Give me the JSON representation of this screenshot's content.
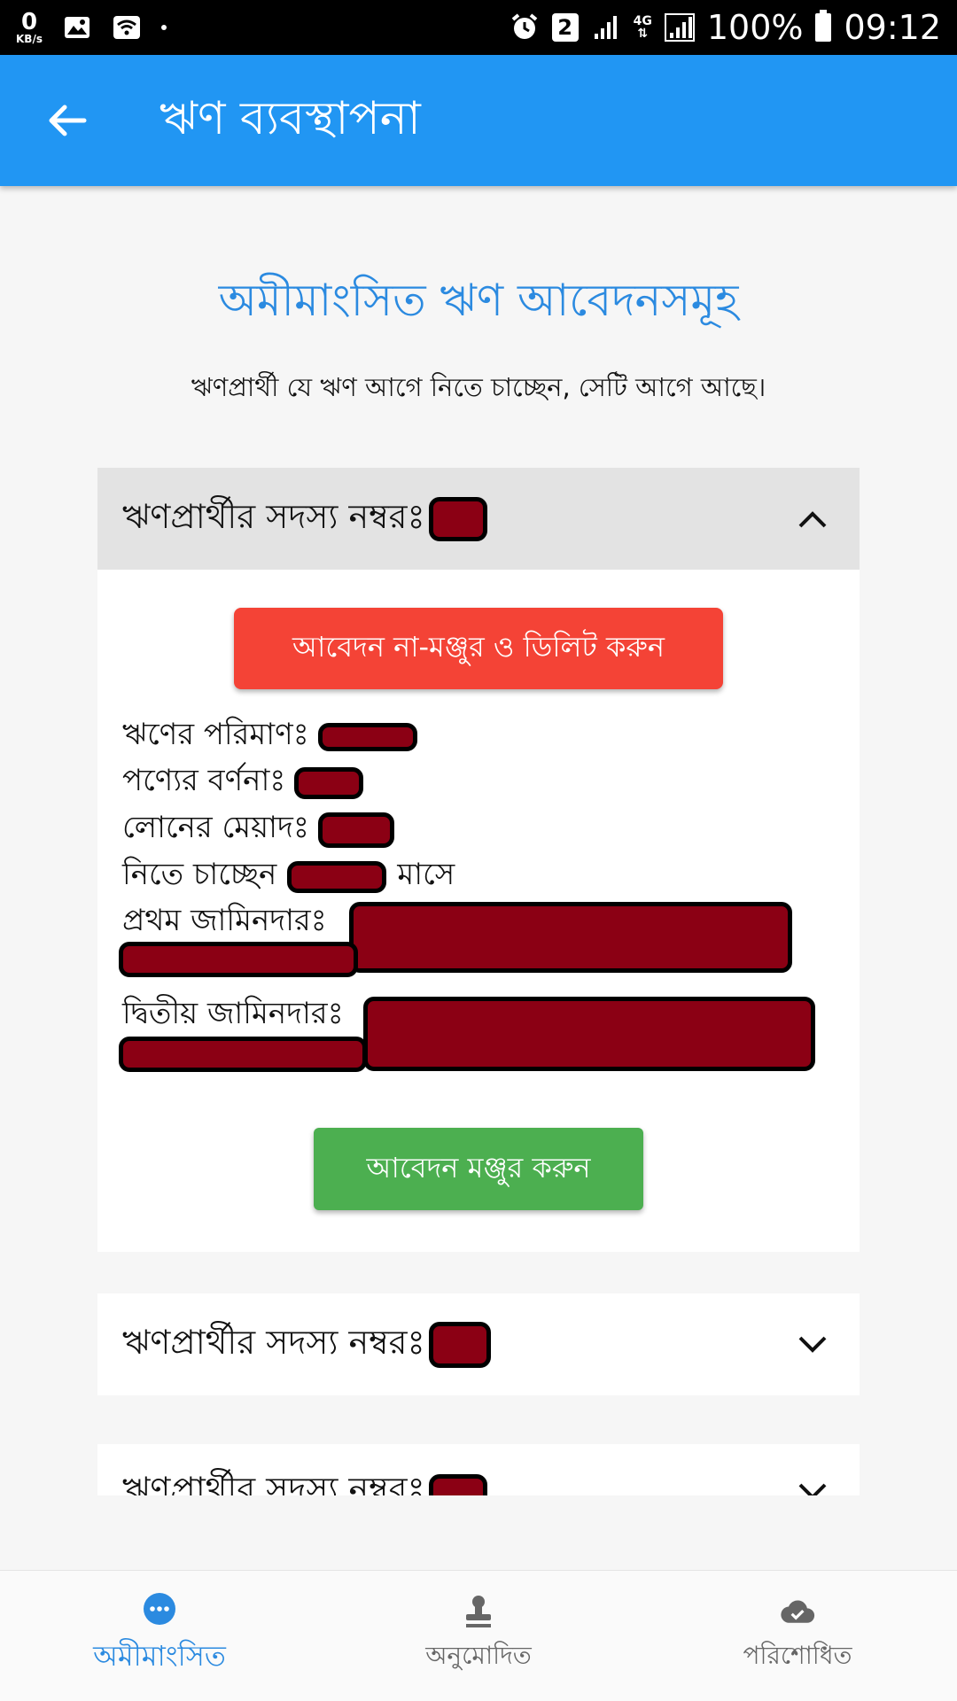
{
  "status_bar": {
    "speed_value": "0",
    "speed_unit": "KB/s",
    "sim_slot": "2",
    "network": "4G",
    "battery": "100%",
    "time": "09:12"
  },
  "app_bar": {
    "title": "ঋণ ব্যবস্থাপনা"
  },
  "page": {
    "title": "অমীমাংসিত ঋণ আবেদনসমূহ",
    "subtitle": "ঋণপ্রার্থী যে ঋণ আগে নিতে চাচ্ছেন, সেটি আগে আছে।"
  },
  "cards": [
    {
      "label": "ঋণপ্রার্থীর সদস্য নম্বরঃ",
      "expanded": true,
      "reject_button": "আবেদন না-মঞ্জুর ও ডিলিট করুন",
      "details": {
        "amount_label": "ঋণের পরিমাণঃ",
        "product_label": "পণ্যের বর্ণনাঃ",
        "duration_label": "লোনের মেয়াদঃ",
        "take_label": "নিতে চাচ্ছেন",
        "take_suffix": "মাসে",
        "guarantor1_label": "প্রথম জামিনদারঃ",
        "guarantor2_label": "দ্বিতীয় জামিনদারঃ"
      },
      "approve_button": "আবেদন মঞ্জুর করুন"
    },
    {
      "label": "ঋণপ্রার্থীর সদস্য নম্বরঃ",
      "expanded": false
    },
    {
      "label": "ঋণপ্রার্থীর সদস্য নম্বরঃ",
      "expanded": false
    }
  ],
  "bottom_nav": [
    {
      "label": "অমীমাংসিত",
      "icon": "more-circle-icon",
      "active": true
    },
    {
      "label": "অনুমোদিত",
      "icon": "stamp-icon",
      "active": false
    },
    {
      "label": "পরিশোধিত",
      "icon": "cloud-done-icon",
      "active": false
    }
  ],
  "colors": {
    "primary": "#2196f3",
    "title_blue": "#2b8ae0",
    "reject_red": "#f44336",
    "approve_green": "#4caf50",
    "redaction": "#8b0014"
  }
}
